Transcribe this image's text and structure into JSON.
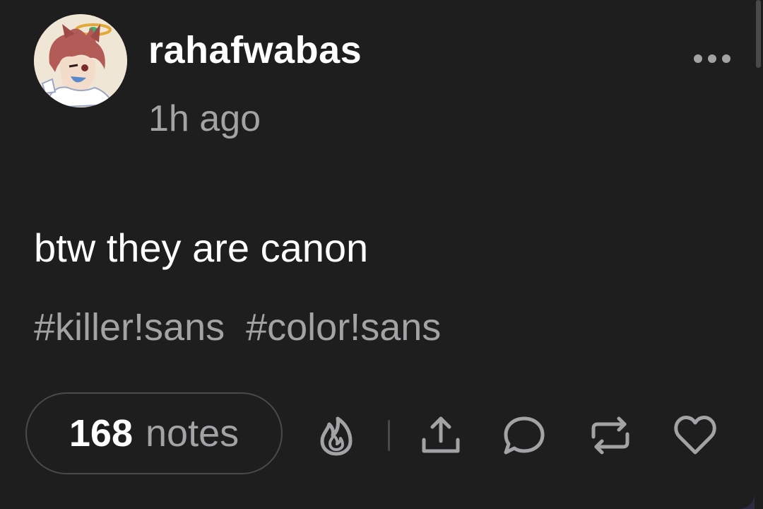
{
  "post": {
    "username": "rahafwabas",
    "timestamp": "1h ago",
    "body": "btw they are canon",
    "tags": [
      "#killer!sans",
      "#color!sans"
    ],
    "notes_count": "168",
    "notes_label": "notes"
  },
  "icons": {
    "more": "more-options-icon",
    "blaze": "flame-icon",
    "share": "share-icon",
    "reply": "reply-icon",
    "reblog": "reblog-icon",
    "like": "heart-icon"
  },
  "colors": {
    "card_background": "#1e1e1f",
    "page_background": "#2e2a40",
    "text_primary": "#ffffff",
    "text_secondary": "#a3a3a6"
  }
}
